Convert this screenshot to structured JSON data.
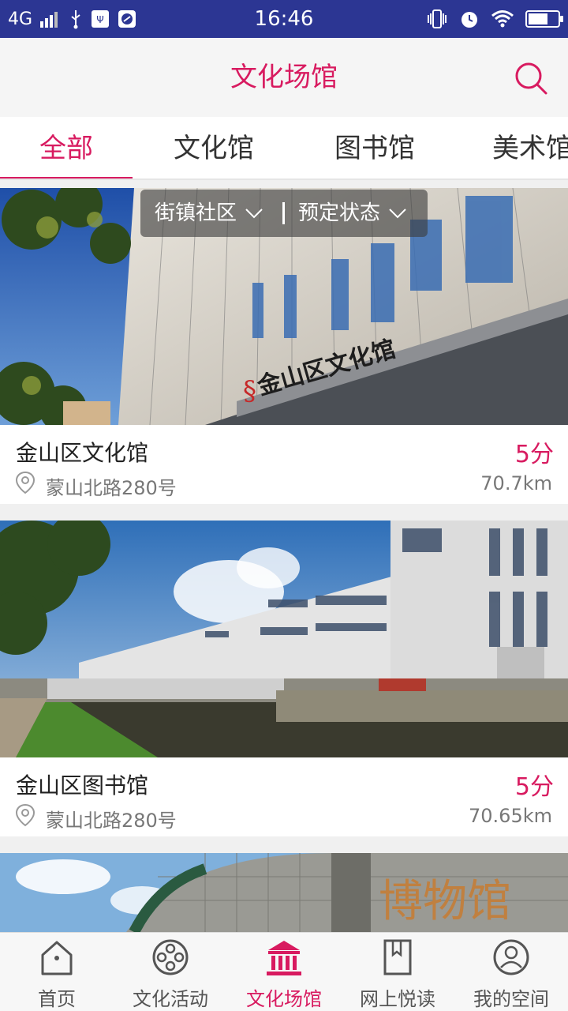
{
  "status_bar": {
    "network": "4G",
    "time": "16:46"
  },
  "header": {
    "title": "文化场馆"
  },
  "tabs": [
    {
      "label": "全部",
      "active": true
    },
    {
      "label": "文化馆",
      "active": false
    },
    {
      "label": "图书馆",
      "active": false
    },
    {
      "label": "美术馆",
      "active": false
    }
  ],
  "filters": [
    {
      "label": "街镇社区"
    },
    {
      "label": "预定状态"
    }
  ],
  "venues": [
    {
      "name": "金山区文化馆",
      "score": "5分",
      "address": "蒙山北路280号",
      "distance": "70.7km",
      "sign": "金山区文化馆"
    },
    {
      "name": "金山区图书馆",
      "score": "5分",
      "address": "蒙山北路280号",
      "distance": "70.65km"
    },
    {
      "name": "",
      "score": "",
      "address": "",
      "distance": "",
      "sign": "博物馆"
    }
  ],
  "bottom_nav": [
    {
      "label": "首页",
      "icon": "home-icon",
      "active": false
    },
    {
      "label": "文化活动",
      "icon": "film-reel-icon",
      "active": false
    },
    {
      "label": "文化场馆",
      "icon": "museum-icon",
      "active": true
    },
    {
      "label": "网上悦读",
      "icon": "book-icon",
      "active": false
    },
    {
      "label": "我的空间",
      "icon": "user-icon",
      "active": false
    }
  ],
  "colors": {
    "accent": "#d81b60",
    "status_bar": "#2c3693"
  }
}
